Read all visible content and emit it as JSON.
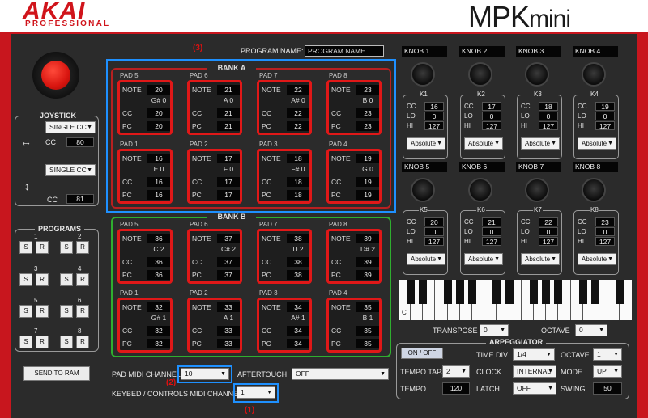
{
  "header": {
    "brand": "AKAI",
    "brand_sub": "PROFESSIONAL",
    "product": "MPK",
    "product_suffix": "mini"
  },
  "program_name": {
    "label": "PROGRAM NAME:",
    "value": "PROGRAM NAME"
  },
  "annotations": {
    "a1": "(1)",
    "a2": "(2)",
    "a3": "(3)"
  },
  "joystick": {
    "title": "JOYSTICK",
    "x_mode": "SINGLE CC",
    "x_cc_label": "CC",
    "x_cc": "80",
    "y_mode": "SINGLE CC",
    "y_cc_label": "CC",
    "y_cc": "81"
  },
  "programs": {
    "title": "PROGRAMS",
    "s": "S",
    "r": "R",
    "numbers": [
      "1",
      "2",
      "3",
      "4",
      "5",
      "6",
      "7",
      "8"
    ],
    "send": "SEND TO RAM"
  },
  "bank_a": {
    "title": "BANK A",
    "pads": [
      {
        "name": "PAD 5",
        "note": "20",
        "notename": "G# 0",
        "cc": "20",
        "pc": "20"
      },
      {
        "name": "PAD 6",
        "note": "21",
        "notename": "A 0",
        "cc": "21",
        "pc": "21"
      },
      {
        "name": "PAD 7",
        "note": "22",
        "notename": "A# 0",
        "cc": "22",
        "pc": "22"
      },
      {
        "name": "PAD 8",
        "note": "23",
        "notename": "B 0",
        "cc": "23",
        "pc": "23"
      },
      {
        "name": "PAD 1",
        "note": "16",
        "notename": "E 0",
        "cc": "16",
        "pc": "16"
      },
      {
        "name": "PAD 2",
        "note": "17",
        "notename": "F 0",
        "cc": "17",
        "pc": "17"
      },
      {
        "name": "PAD 3",
        "note": "18",
        "notename": "F# 0",
        "cc": "18",
        "pc": "18"
      },
      {
        "name": "PAD 4",
        "note": "19",
        "notename": "G 0",
        "cc": "19",
        "pc": "19"
      }
    ]
  },
  "bank_b": {
    "title": "BANK B",
    "pads": [
      {
        "name": "PAD 5",
        "note": "36",
        "notename": "C 2",
        "cc": "36",
        "pc": "36"
      },
      {
        "name": "PAD 6",
        "note": "37",
        "notename": "C# 2",
        "cc": "37",
        "pc": "37"
      },
      {
        "name": "PAD 7",
        "note": "38",
        "notename": "D 2",
        "cc": "38",
        "pc": "38"
      },
      {
        "name": "PAD 8",
        "note": "39",
        "notename": "D# 2",
        "cc": "39",
        "pc": "39"
      },
      {
        "name": "PAD 1",
        "note": "32",
        "notename": "G# 1",
        "cc": "32",
        "pc": "32"
      },
      {
        "name": "PAD 2",
        "note": "33",
        "notename": "A 1",
        "cc": "33",
        "pc": "33"
      },
      {
        "name": "PAD 3",
        "note": "34",
        "notename": "A# 1",
        "cc": "34",
        "pc": "34"
      },
      {
        "name": "PAD 4",
        "note": "35",
        "notename": "B 1",
        "cc": "35",
        "pc": "35"
      }
    ]
  },
  "pad_labels": {
    "note": "NOTE",
    "cc": "CC",
    "pc": "PC"
  },
  "knobs": [
    {
      "name": "KNOB 1",
      "id": "K1",
      "cc": "16",
      "lo": "0",
      "hi": "127",
      "mode": "Absolute"
    },
    {
      "name": "KNOB 2",
      "id": "K2",
      "cc": "17",
      "lo": "0",
      "hi": "127",
      "mode": "Absolute"
    },
    {
      "name": "KNOB 3",
      "id": "K3",
      "cc": "18",
      "lo": "0",
      "hi": "127",
      "mode": "Absolute"
    },
    {
      "name": "KNOB 4",
      "id": "K4",
      "cc": "19",
      "lo": "0",
      "hi": "127",
      "mode": "Absolute"
    },
    {
      "name": "KNOB 5",
      "id": "K5",
      "cc": "20",
      "lo": "0",
      "hi": "127",
      "mode": "Absolute"
    },
    {
      "name": "KNOB 6",
      "id": "K6",
      "cc": "21",
      "lo": "0",
      "hi": "127",
      "mode": "Absolute"
    },
    {
      "name": "KNOB 7",
      "id": "K7",
      "cc": "22",
      "lo": "0",
      "hi": "127",
      "mode": "Absolute"
    },
    {
      "name": "KNOB 8",
      "id": "K8",
      "cc": "23",
      "lo": "0",
      "hi": "127",
      "mode": "Absolute"
    }
  ],
  "knob_labels": {
    "cc": "CC",
    "lo": "LO",
    "hi": "HI"
  },
  "keyboard": {
    "c_label": "C",
    "transpose_label": "TRANSPOSE",
    "transpose": "0",
    "octave_label": "OCTAVE",
    "octave": "0"
  },
  "arp": {
    "title": "ARPEGGIATOR",
    "onoff": "ON / OFF",
    "timediv_label": "TIME DIV",
    "timediv": "1/4",
    "octave_label": "OCTAVE",
    "octave": "1",
    "taps_label": "TEMPO TAPS",
    "taps": "2",
    "clock_label": "CLOCK",
    "clock": "INTERNAL",
    "mode_label": "MODE",
    "mode": "UP",
    "tempo_label": "TEMPO",
    "tempo": "120",
    "latch_label": "LATCH",
    "latch": "OFF",
    "swing_label": "SWING",
    "swing": "50"
  },
  "bottom": {
    "pad_ch_label": "PAD MIDI CHANNEL",
    "pad_ch": "10",
    "aftertouch_label": "AFTERTOUCH",
    "aftertouch": "OFF",
    "keybed_label": "KEYBED / CONTROLS MIDI CHANNEL",
    "keybed": "1"
  }
}
